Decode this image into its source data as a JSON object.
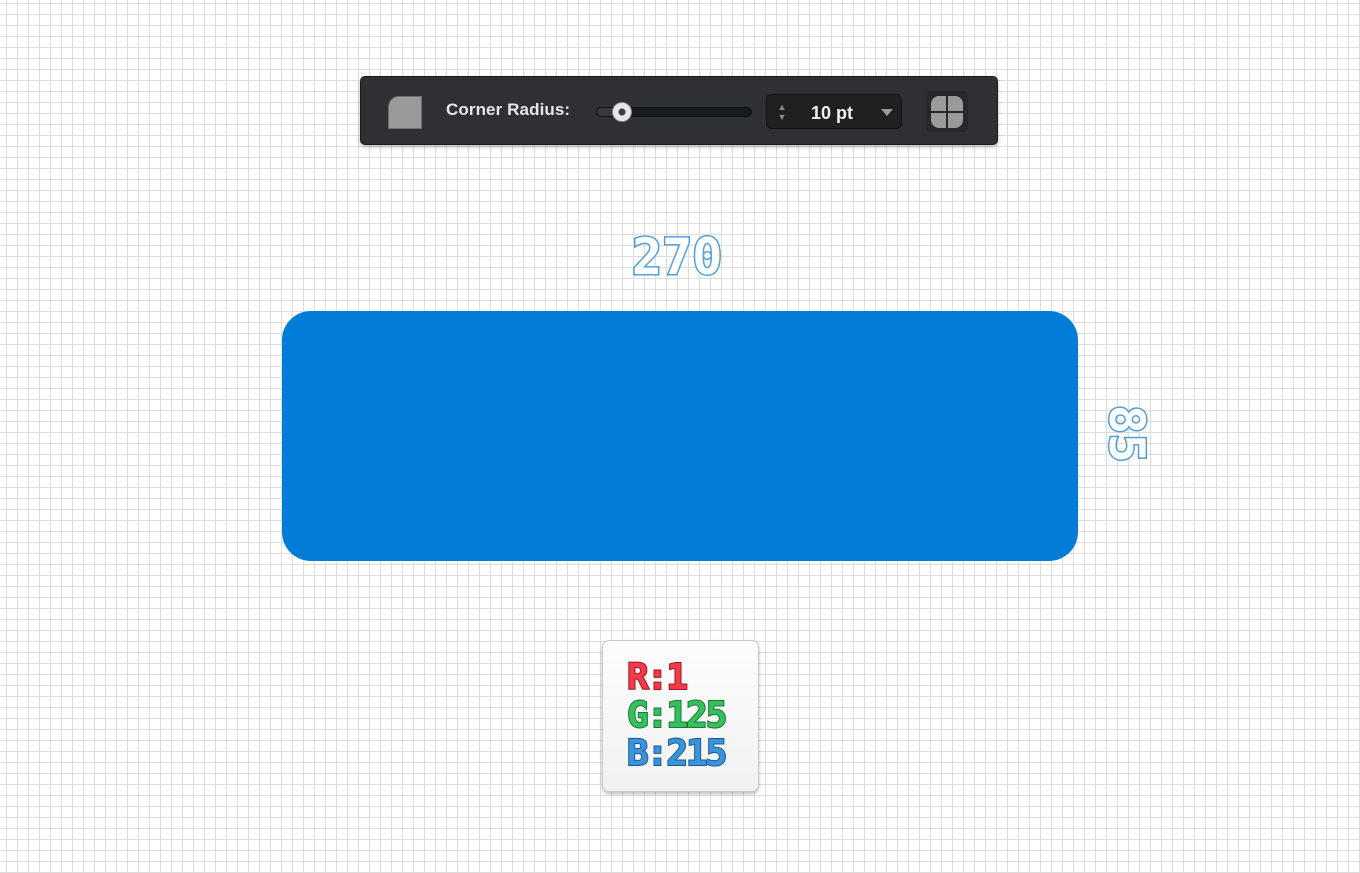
{
  "toolbar": {
    "corner_icon": "rounded-corner-icon",
    "label": "Corner Radius:",
    "slider_value_fraction": 0.16,
    "stepper_arrows_icon": "up-down-arrows-icon",
    "stepper_value": "10 pt",
    "dropdown_icon": "chevron-down-icon",
    "grid_icon": "independent-corners-icon"
  },
  "dimensions": {
    "width": "270",
    "height": "85"
  },
  "shape": {
    "fill_color": "#017dd7"
  },
  "color_card": {
    "r_line": "R:1",
    "g_line": "G:125",
    "b_line": "B:215"
  }
}
